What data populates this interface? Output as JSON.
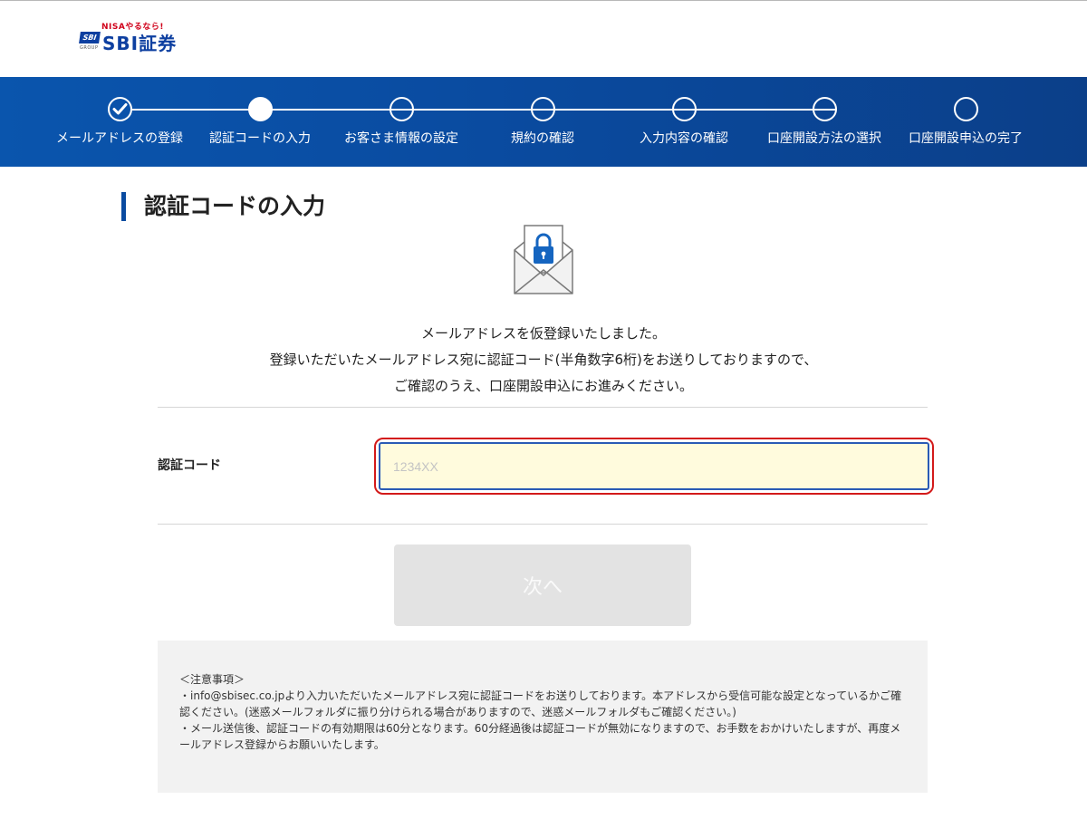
{
  "logo": {
    "tagline": "NISAやるなら!",
    "mark": "SBI",
    "group": "GROUP",
    "name": "SBI証券"
  },
  "steps": [
    {
      "label": "メールアドレスの登録",
      "state": "done"
    },
    {
      "label": "認証コードの入力",
      "state": "current"
    },
    {
      "label": "お客さま情報の設定",
      "state": "upcoming"
    },
    {
      "label": "規約の確認",
      "state": "upcoming"
    },
    {
      "label": "入力内容の確認",
      "state": "upcoming"
    },
    {
      "label": "口座開設方法の選択",
      "state": "upcoming"
    },
    {
      "label": "口座開設申込の完了",
      "state": "upcoming"
    }
  ],
  "page": {
    "title": "認証コードの入力",
    "message_lines": [
      "メールアドレスを仮登録いたしました。",
      "登録いただいたメールアドレス宛に認証コード(半角数字6桁)をお送りしておりますので、",
      "ご確認のうえ、口座開設申込にお進みください。"
    ]
  },
  "form": {
    "code_label": "認証コード",
    "code_placeholder": "1234XX",
    "code_value": "",
    "next_label": "次へ"
  },
  "notes": {
    "heading": "＜注意事項＞",
    "items": [
      "・info@sbisec.co.jpより入力いただいたメールアドレス宛に認証コードをお送りしております。本アドレスから受信可能な設定となっているかご確認ください。(迷惑メールフォルダに振り分けられる場合がありますので、迷惑メールフォルダもご確認ください。)",
      "・メール送信後、認証コードの有効期限は60分となります。60分経過後は認証コードが無効になりますので、お手数をおかけいたしますが、再度メールアドレス登録からお願いいたします。"
    ]
  },
  "colors": {
    "brand_blue": "#0a4ba0",
    "input_highlight": "#d31a1a",
    "input_background": "#fffbdd",
    "disabled_button": "#e3e3e3"
  }
}
